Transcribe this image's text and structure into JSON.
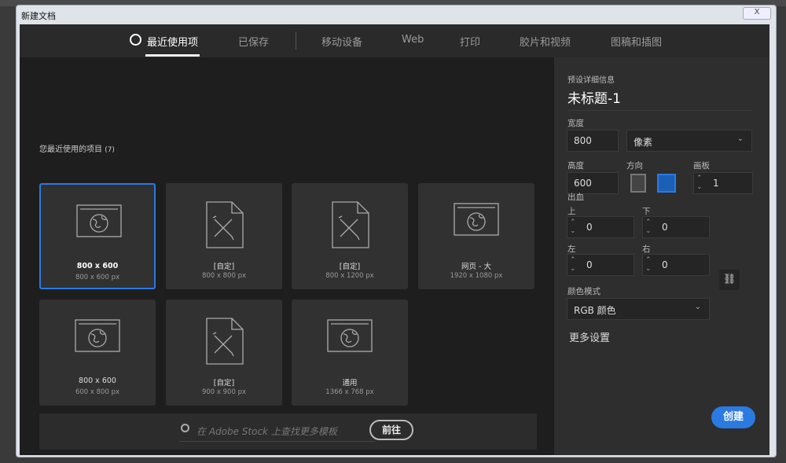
{
  "window": {
    "title": "新建文档",
    "close": "X"
  },
  "tabs": [
    "最近使用项",
    "已保存",
    "移动设备",
    "Web",
    "打印",
    "胶片和视频",
    "图稿和插图"
  ],
  "recent": {
    "title": "您最近使用的项目",
    "count": "(7)",
    "items": [
      {
        "name": "800 x 600",
        "size": "800 x 600 px",
        "icon": "web-icon"
      },
      {
        "name": "[自定]",
        "size": "800 x 800 px",
        "icon": "custom-doc-icon"
      },
      {
        "name": "[自定]",
        "size": "800 x 1200 px",
        "icon": "custom-doc-icon"
      },
      {
        "name": "网页 - 大",
        "size": "1920 x 1080 px",
        "icon": "web-icon"
      },
      {
        "name": "800 x 600",
        "size": "600 x 800 px",
        "icon": "web-icon"
      },
      {
        "name": "[自定]",
        "size": "900 x 900 px",
        "icon": "custom-doc-icon"
      },
      {
        "name": "通用",
        "size": "1366 x 768 px",
        "icon": "web-icon"
      }
    ]
  },
  "stock": {
    "placeholder": "在 Adobe Stock 上查找更多模板",
    "go": "前往"
  },
  "details": {
    "header": "预设详细信息",
    "doc_name": "未标题-1",
    "width_label": "宽度",
    "width": "800",
    "unit": "像素",
    "height_label": "高度",
    "height": "600",
    "orientation_label": "方向",
    "artboard_label": "画板",
    "artboards": "1",
    "bleed_label": "出血",
    "top_label": "上",
    "top": "0",
    "bottom_label": "下",
    "bottom": "0",
    "left_label": "左",
    "left": "0",
    "right_label": "右",
    "right": "0",
    "color_mode_label": "颜色模式",
    "color_mode": "RGB 颜色",
    "more": "更多设置",
    "create": "创建"
  }
}
